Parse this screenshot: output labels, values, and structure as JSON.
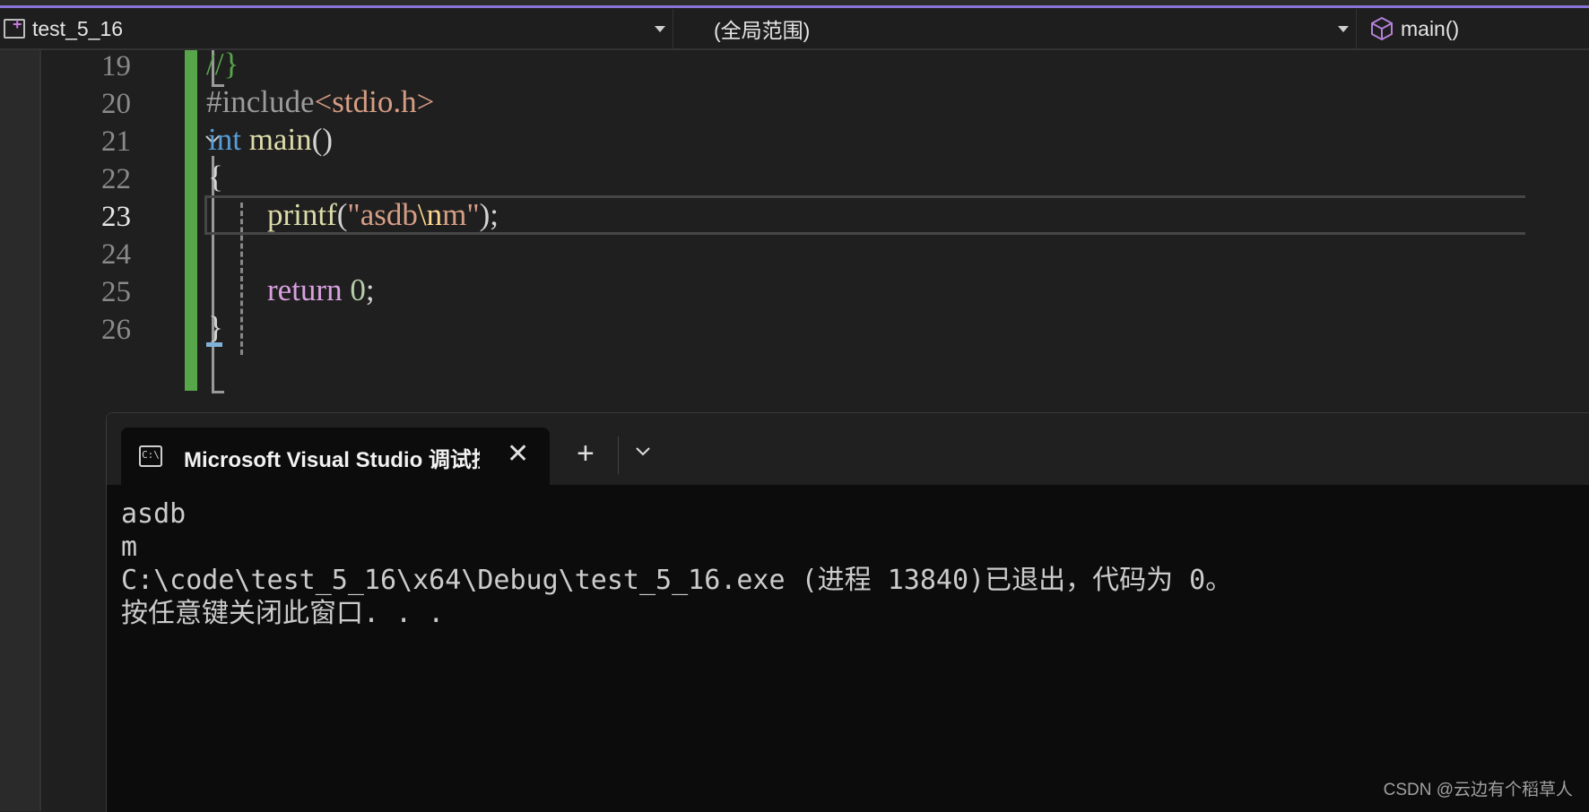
{
  "navbar": {
    "project": "test_5_16",
    "scope": "(全局范围)",
    "member": "main()"
  },
  "editor": {
    "line_numbers": [
      "19",
      "20",
      "21",
      "22",
      "23",
      "24",
      "25",
      "26"
    ],
    "current_line": "23",
    "lines": {
      "l19": "//}",
      "l20_directive": "#include",
      "l20_header": "<stdio.h>",
      "l21_kw": "int",
      "l21_fn": "main",
      "l21_paren": "()",
      "l22": "{",
      "l23_fn": "printf",
      "l23_open": "(",
      "l23_str1": "\"asdb",
      "l23_esc": "\\n",
      "l23_str2": "m\"",
      "l23_close": ");",
      "l25_kw": "return",
      "l25_num": "0",
      "l25_semi": ";",
      "l26": "}"
    }
  },
  "console": {
    "tab_title": "Microsoft Visual Studio 调试控制台",
    "tab_icon_text": "C:\\",
    "output": [
      "asdb",
      "m",
      "C:\\code\\test_5_16\\x64\\Debug\\test_5_16.exe (进程 13840)已退出，代码为 0。",
      "按任意键关闭此窗口. . ."
    ]
  },
  "watermark": "CSDN @云边有个稻草人",
  "colors": {
    "accent": "#8a74d6",
    "changed_margin": "#57a64a",
    "keyword": "#569cd6",
    "string": "#d69d85",
    "control_keyword": "#d8a0df",
    "function": "#dcdcaa"
  },
  "icons": {
    "project": "project-icon",
    "member": "cube-icon",
    "console": "console-icon",
    "close": "close-icon",
    "new_tab": "plus-icon",
    "dropdown": "chevron-down-icon"
  }
}
